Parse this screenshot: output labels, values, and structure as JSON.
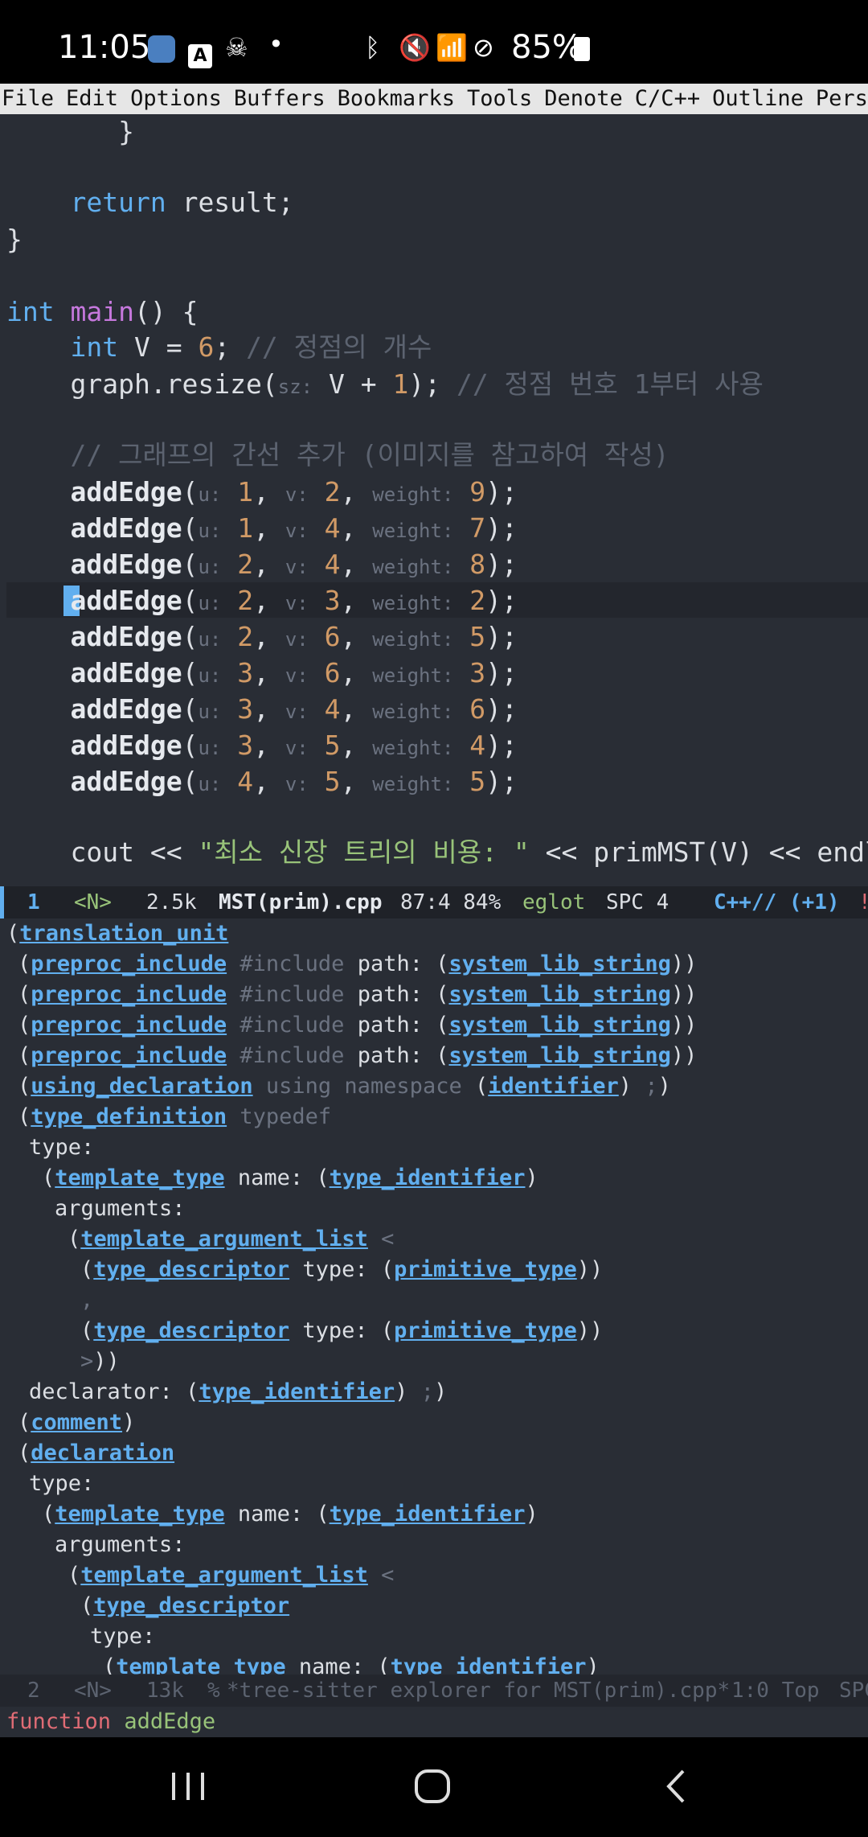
{
  "status_bar": {
    "time": "11:05",
    "battery": "85%"
  },
  "menu": [
    "File",
    "Edit",
    "Options",
    "Buffers",
    "Bookmarks",
    "Tools",
    "Denote",
    "C/C++",
    "Outline",
    "Perspective"
  ],
  "code": {
    "l01": "}",
    "l02_kw": "return",
    "l02_rest": " result;",
    "l03": "}",
    "l04_ty": "int",
    "l04_fn": "main",
    "l04_rest": "() {",
    "l05_ty": "int",
    "l05_a": " V = ",
    "l05_num": "6",
    "l05_b": "; ",
    "l05_cm": "// 정점의 개수",
    "l06_a": "graph.resize(",
    "l06_hint": "sz:",
    "l06_b": " V + ",
    "l06_num": "1",
    "l06_c": "); ",
    "l06_cm": "// 정점 번호 1부터 사용",
    "l07_cm": "// 그래프의 간선 추가 (이미지를 참고하여 작성)",
    "edge_fn": "addEdge",
    "hint_u": "u:",
    "hint_v": "v:",
    "hint_w": "weight:",
    "edges": [
      {
        "u": "1",
        "v": "2",
        "w": "9"
      },
      {
        "u": "1",
        "v": "4",
        "w": "7"
      },
      {
        "u": "2",
        "v": "4",
        "w": "8"
      },
      {
        "u": "2",
        "v": "3",
        "w": "2"
      },
      {
        "u": "2",
        "v": "6",
        "w": "5"
      },
      {
        "u": "3",
        "v": "6",
        "w": "3"
      },
      {
        "u": "3",
        "v": "4",
        "w": "6"
      },
      {
        "u": "3",
        "v": "5",
        "w": "4"
      },
      {
        "u": "4",
        "v": "5",
        "w": "5"
      }
    ],
    "l_cout_a": "cout << ",
    "l_cout_str": "\"최소 신장 트리의 비용: \"",
    "l_cout_b": " << primMST(V) << endl"
  },
  "modeline1": {
    "window": "1",
    "state": "<N>",
    "size": "2.5k",
    "buffer": "MST(prim).cpp",
    "pos": "87:4 84%",
    "lsp": "eglot",
    "indent": "SPC 4",
    "mode": "C++// (+1)",
    "flag": "!"
  },
  "tree": {
    "translation_unit": "translation_unit",
    "preproc_include": "preproc_include",
    "include_kw": "#include",
    "path": "path:",
    "system_lib_string": "system_lib_string",
    "using_declaration": "using_declaration",
    "using_text": "using namespace",
    "identifier": "identifier",
    "semi": ";",
    "type_definition": "type_definition",
    "typedef": "typedef",
    "type_field": "type:",
    "template_type": "template_type",
    "name_field": "name:",
    "type_identifier": "type_identifier",
    "arguments_field": "arguments:",
    "template_argument_list": "template_argument_list",
    "lt": "<",
    "type_descriptor": "type_descriptor",
    "primitive_type": "primitive_type",
    "comma": ",",
    "gt": ">",
    "declarator_field": "declarator:",
    "comment": "comment",
    "declaration": "declaration"
  },
  "modeline2": {
    "window": "2",
    "state": "<N>",
    "size": "13k",
    "mark": "%",
    "buffer": "*tree-sitter explorer for MST(prim).cpp*",
    "pos": "1:0 Top",
    "indent": "SPC"
  },
  "echo": {
    "kind": "function",
    "name": "addEdge"
  },
  "colors": {
    "bg": "#292d35",
    "keyword": "#61afef",
    "function": "#c678dd",
    "number": "#d19a66",
    "comment": "#5c6370",
    "string": "#98c379"
  }
}
